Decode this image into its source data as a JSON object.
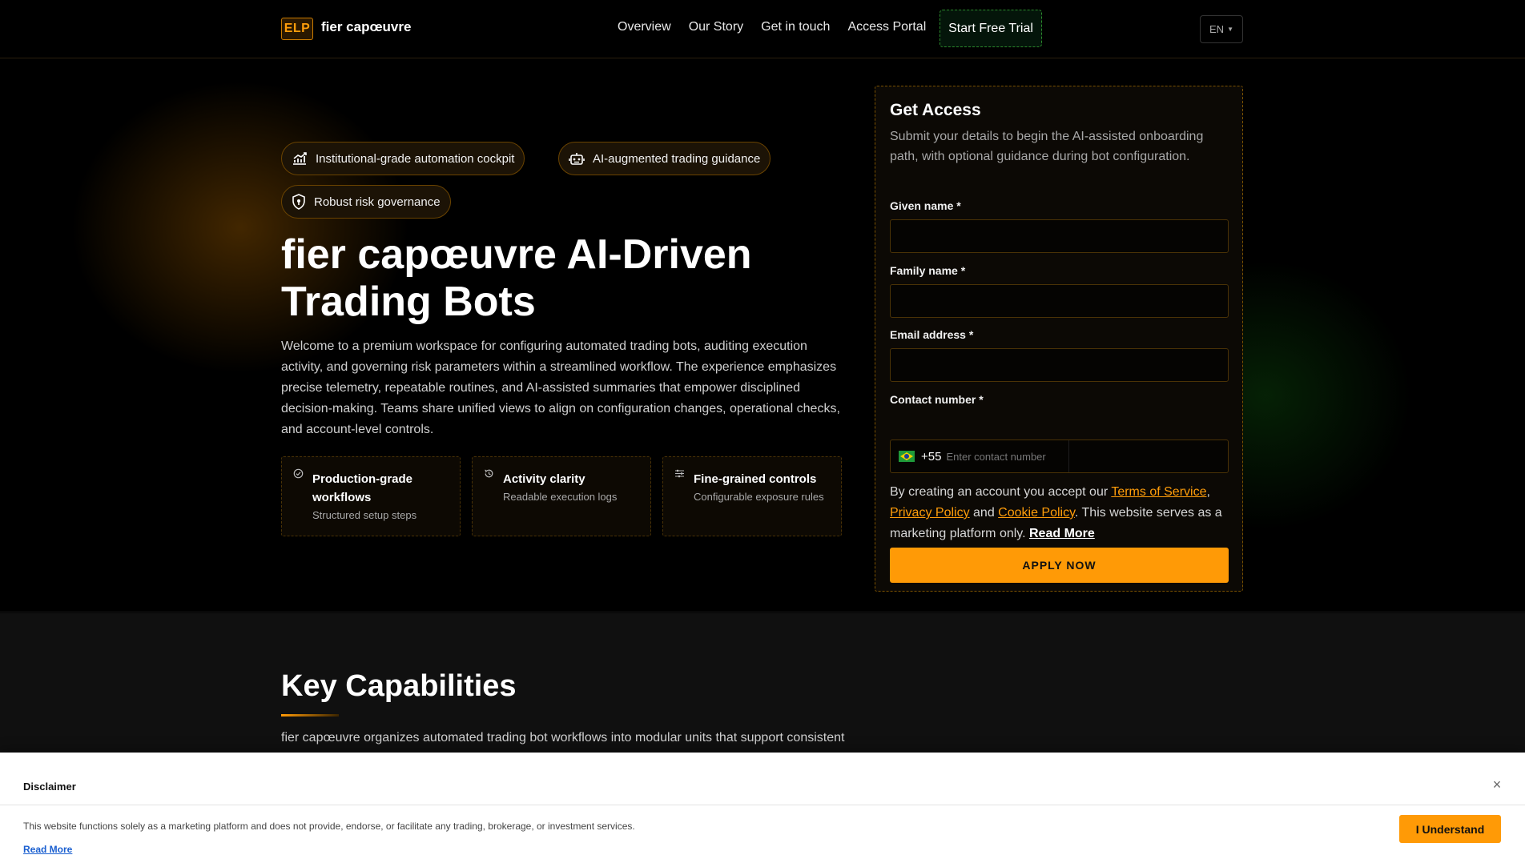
{
  "header": {
    "logo_badge": "ELP",
    "brand": "fier capœuvre",
    "nav": [
      "Overview",
      "Our Story",
      "Get in touch",
      "Access Portal"
    ],
    "cta": "Start Free Trial",
    "language": "EN"
  },
  "hero": {
    "pills": [
      {
        "label": "Institutional-grade automation cockpit",
        "icon": "chart-up-icon"
      },
      {
        "label": "AI-augmented trading guidance",
        "icon": "robot-icon"
      },
      {
        "label": "Robust risk governance",
        "icon": "shield-icon"
      }
    ],
    "title": "fier capœuvre AI-Driven Trading Bots",
    "description": "Welcome to a premium workspace for configuring automated trading bots, auditing execution activity, and governing risk parameters within a streamlined workflow. The experience emphasizes precise telemetry, repeatable routines, and AI-assisted summaries that empower disciplined decision-making. Teams share unified views to align on configuration changes, operational checks, and account-level controls.",
    "features": [
      {
        "title": "Production-grade workflows",
        "desc": "Structured setup steps",
        "icon": "check-circle-icon"
      },
      {
        "title": "Activity clarity",
        "desc": "Readable execution logs",
        "icon": "history-icon"
      },
      {
        "title": "Fine-grained controls",
        "desc": "Configurable exposure rules",
        "icon": "sliders-icon"
      }
    ]
  },
  "form": {
    "title": "Get Access",
    "subtitle": "Submit your details to begin the AI-assisted onboarding path, with optional guidance during bot configuration.",
    "given_name_label": "Given name *",
    "family_name_label": "Family name *",
    "email_label": "Email address *",
    "phone_label": "Contact number *",
    "phone_code": "+55",
    "phone_placeholder": "Enter contact number",
    "terms_prefix": "By creating an account you accept our ",
    "terms_link": "Terms of Service",
    "privacy_link": "Privacy Policy",
    "and_text": " and ",
    "cookie_link": "Cookie Policy",
    "terms_suffix": ". This website serves as a marketing platform only. ",
    "read_more": "Read More",
    "submit": "APPLY NOW"
  },
  "capabilities": {
    "title": "Key Capabilities",
    "text": "fier capœuvre organizes automated trading bot workflows into modular units that support consistent"
  },
  "disclaimer": {
    "title": "Disclaimer",
    "close": "×",
    "text": "This website functions solely as a marketing platform and does not provide, endorse, or facilitate any trading, brokerage, or investment services.",
    "read_more": "Read More",
    "button": "I Understand"
  },
  "colors": {
    "accent": "#ff9a06",
    "background": "#000000",
    "trial_border": "#2c8a2c"
  }
}
